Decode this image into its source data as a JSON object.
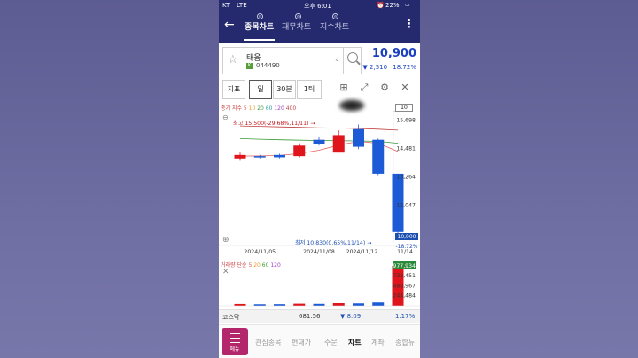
{
  "status": {
    "carrier": "KT",
    "network": "LTE",
    "time": "오후 6:01",
    "battery": "22%"
  },
  "appbar": {
    "tabs": [
      {
        "label": "종목차트"
      },
      {
        "label": "재무차트"
      },
      {
        "label": "지수차트"
      }
    ]
  },
  "stock": {
    "name": "태웅",
    "code": "044490",
    "price": "10,900",
    "change": "▼ 2,510",
    "change_pct": "18.72%"
  },
  "tools": {
    "indicator_btn": "지표",
    "period_day": "일",
    "period_30min": "30분",
    "period_tick": "1틱"
  },
  "indicator_labels": {
    "ma_title": "종가 지수",
    "ma_periods": [
      "5",
      "10",
      "20",
      "60",
      "120",
      "400"
    ],
    "box_value": "10"
  },
  "chart_data": {
    "type": "candlestick",
    "x_labels": [
      "2024/11/05",
      "2024/11/08",
      "2024/11/12",
      "11/14"
    ],
    "y_ticks": [
      15698,
      14481,
      13264,
      12047,
      10900
    ],
    "ylim": [
      10400,
      15900
    ],
    "high_annotation": "최고 15,500(-29.68%,11/11)",
    "low_annotation": "최저 10,830(0.65%,11/14)",
    "current_tag": "10,900",
    "current_change_tag": "-18.72%",
    "candles": [
      {
        "o": 14050,
        "c": 14200,
        "h": 14300,
        "l": 13950,
        "dir": "up"
      },
      {
        "o": 14150,
        "c": 14100,
        "h": 14200,
        "l": 14050,
        "dir": "down"
      },
      {
        "o": 14100,
        "c": 14200,
        "h": 14250,
        "l": 14050,
        "dir": "down"
      },
      {
        "o": 14150,
        "c": 14600,
        "h": 14700,
        "l": 14100,
        "dir": "up"
      },
      {
        "o": 14850,
        "c": 14650,
        "h": 14950,
        "l": 14600,
        "dir": "down"
      },
      {
        "o": 14300,
        "c": 15050,
        "h": 15250,
        "l": 14300,
        "dir": "up"
      },
      {
        "o": 15300,
        "c": 14550,
        "h": 15500,
        "l": 14450,
        "dir": "down"
      },
      {
        "o": 14850,
        "c": 13400,
        "h": 14900,
        "l": 13300,
        "dir": "down"
      },
      {
        "o": 13400,
        "c": 10900,
        "h": 13400,
        "l": 10830,
        "dir": "down"
      }
    ],
    "ma_lines": [
      {
        "name": "5",
        "color": "#e06060",
        "values": [
          14150,
          14160,
          14180,
          14260,
          14400,
          14620,
          14780,
          14700,
          14350
        ]
      },
      {
        "name": "20",
        "color": "#3a9a3a",
        "values": [
          14900,
          14870,
          14850,
          14830,
          14820,
          14810,
          14800,
          14780,
          14700
        ]
      },
      {
        "name": "60",
        "color": "#c04040",
        "values": [
          15440,
          15420,
          15400,
          15380,
          15360,
          15350,
          15330,
          15300,
          15260
        ]
      }
    ],
    "volume": {
      "ticks": [
        "977,934",
        "733,451",
        "488,967",
        "244,484"
      ],
      "max": 977934,
      "values": [
        45000,
        38000,
        40000,
        52000,
        48000,
        65000,
        60000,
        82000,
        977934
      ],
      "dirs": [
        "up",
        "down",
        "down",
        "up",
        "down",
        "up",
        "down",
        "down",
        "up"
      ],
      "ma_periods": [
        "5",
        "20",
        "60",
        "120"
      ],
      "title": "거래량 단순"
    }
  },
  "index_row": {
    "name": "코스닥",
    "value": "681.56",
    "change": "▼ 8.09",
    "pct": "1.17%"
  },
  "bottom_nav": {
    "menu": "메뉴",
    "items": [
      "관심종목",
      "현재가",
      "주문",
      "차트",
      "계좌",
      "종합뉴"
    ]
  },
  "colors": {
    "up": "#e0151b",
    "down": "#1d5bd6",
    "brand": "#252a6e",
    "menu": "#b3266b"
  }
}
